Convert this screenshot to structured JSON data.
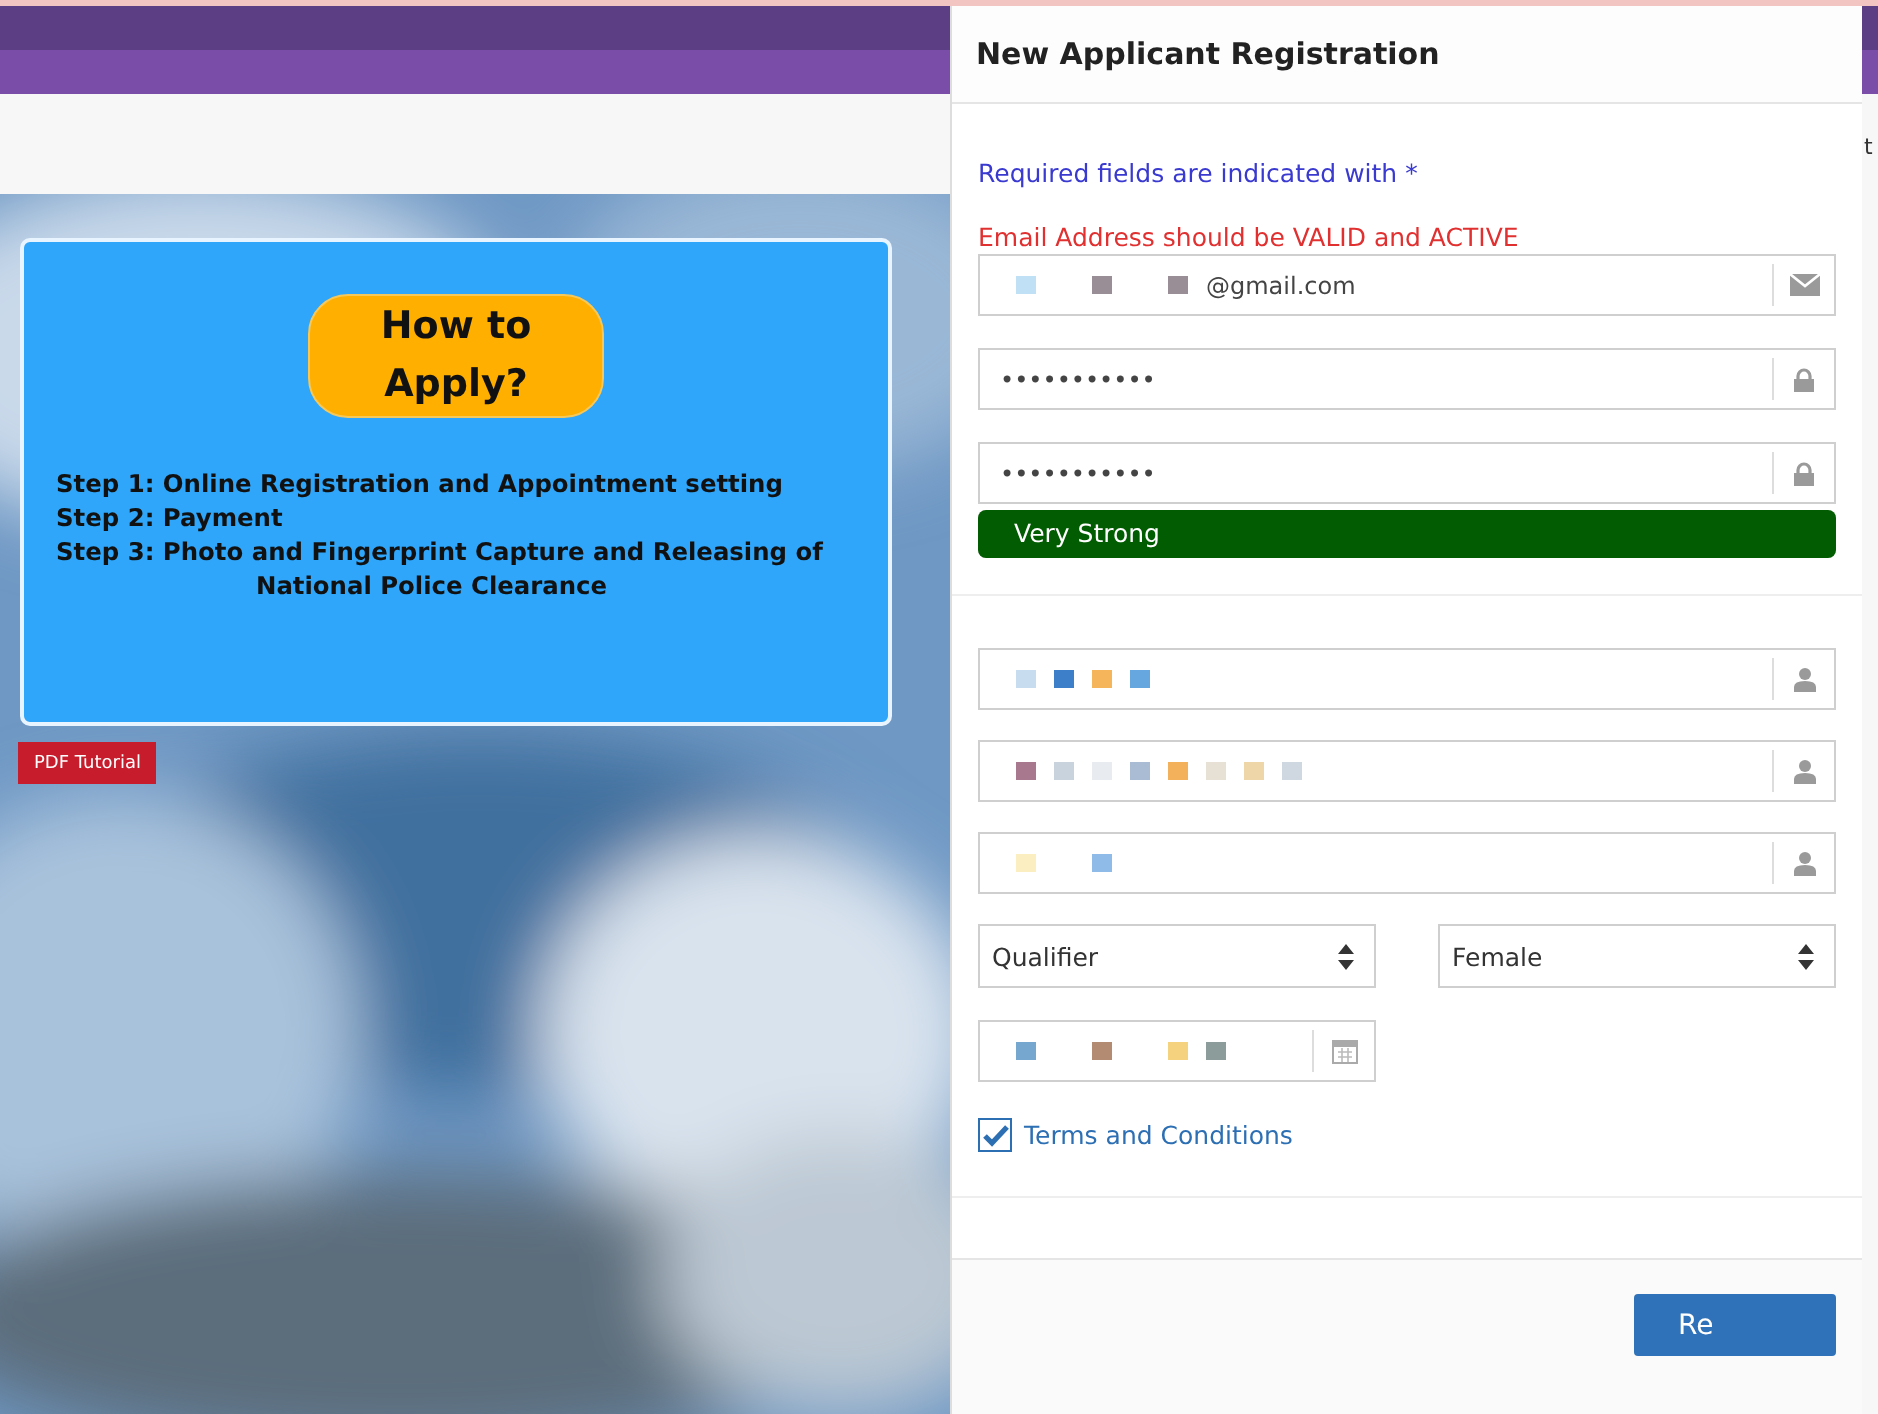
{
  "page": {
    "edge_text": "t"
  },
  "banner": {
    "title": "How to Apply?",
    "lines": [
      {
        "kind": "step",
        "text": "Step 1: Online Registration and Appointment setting"
      },
      {
        "kind": "step",
        "text": "Step 2: Payment"
      },
      {
        "kind": "step",
        "text": "Step 3: Photo and Fingerprint Capture and Releasing of"
      },
      {
        "kind": "continuation",
        "text": "National Police Clearance"
      }
    ]
  },
  "pdf_button": "PDF Tutorial",
  "dialog": {
    "title": "New Applicant Registration",
    "required_note": "Required fields are indicated with *",
    "email_warning": "Email Address should be VALID and ACTIVE",
    "account_fields": [
      {
        "kind": "email",
        "value": "@gmail.com",
        "redacted": true
      },
      {
        "kind": "password",
        "value": "•••••••••••",
        "redacted": false
      },
      {
        "kind": "password",
        "value": "•••••••••••",
        "redacted": false
      }
    ],
    "strength": {
      "label": "Very Strong",
      "level": 1
    },
    "name_fields": [
      {
        "kind": "person",
        "redacted": true
      },
      {
        "kind": "person",
        "redacted": true
      },
      {
        "kind": "person",
        "redacted": true
      }
    ],
    "selects": [
      {
        "value": "Qualifier"
      },
      {
        "value": "Female"
      }
    ],
    "birth_date": {
      "redacted": true
    },
    "terms": {
      "label": "Terms and Conditions",
      "checked": true
    },
    "submit": "Re"
  }
}
